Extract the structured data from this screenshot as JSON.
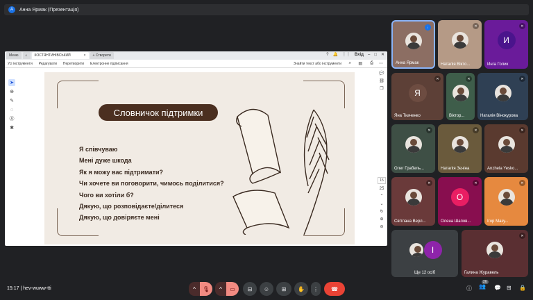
{
  "topbar": {
    "avatar_letter": "А",
    "title": "Анна Ярмак (Презентація)"
  },
  "browser": {
    "tab_menu": "Меню",
    "tab_doc": "КОСТЯНТИНІВСЬКИЙ",
    "tab_new": "Створити",
    "login": "Вхід",
    "toolbar_items": [
      "Усі інструменти",
      "Редагувати",
      "Перетворити",
      "Електронне підписання"
    ],
    "search_text": "Знайти текст або інструменти",
    "page_current": "15",
    "page_total": "25"
  },
  "slide": {
    "title": "Словничок підтримки",
    "phrases": [
      "Я співчуваю",
      "Мені дуже шкода",
      "Як я можу вас підтримати?",
      "Чи хочете ви поговорити, чимось поділитися?",
      "Чого ви хотіли б?",
      "Дякую, що розповідаєте/ділитеся",
      "Дякую, що довіряєте мені"
    ]
  },
  "participants": [
    {
      "name": "Анна Ярмак",
      "kind": "photo",
      "color": "#8c6e63"
    },
    {
      "name": "Наталія Вікто...",
      "kind": "photo",
      "color": "#b59a86"
    },
    {
      "name": "Инга Голик",
      "letter": "И",
      "kind": "letter",
      "color": "#6a1b9a",
      "circle": "#4a148c"
    },
    {
      "name": "Яна Ткаченко",
      "letter": "Я",
      "kind": "letter",
      "color": "#5d4037",
      "circle": "#6d4c41"
    },
    {
      "name": "Віктор...",
      "kind": "photo",
      "color": "#3e5d4a"
    },
    {
      "name": "Наталія Вінокурова",
      "kind": "photo",
      "color": "#2f4054"
    },
    {
      "name": "Олег Грабель...",
      "kind": "photo",
      "color": "#3e4f45"
    },
    {
      "name": "Наталія Зєніна",
      "kind": "photo",
      "color": "#6a5a3c"
    },
    {
      "name": "Anzhela Yesko...",
      "kind": "photo",
      "color": "#5a3a2f"
    },
    {
      "name": "Світлана Верл...",
      "kind": "photo",
      "color": "#6a3a3a"
    },
    {
      "name": "Олена Шапов...",
      "letter": "О",
      "kind": "letter",
      "color": "#880e4f",
      "circle": "#e91e63"
    },
    {
      "name": "Ігор Мазу...",
      "kind": "photo",
      "color": "#e6893f"
    },
    {
      "name": "Ще 12 осіб",
      "letter": "І",
      "kind": "letter",
      "color": "#3c4043",
      "circle": "#8e24aa"
    },
    {
      "name": "Галина Журавель",
      "kind": "photo",
      "color": "#5a2f32"
    }
  ],
  "bottombar": {
    "time": "15:17",
    "separator": "|",
    "code": "hev-wuww-tti",
    "people_count": "26"
  },
  "colors": {
    "end_call": "#ea4335",
    "muted": "#f28b82",
    "slide_title_bg": "#4b2f20",
    "slide_bg": "#f1ebe4"
  }
}
